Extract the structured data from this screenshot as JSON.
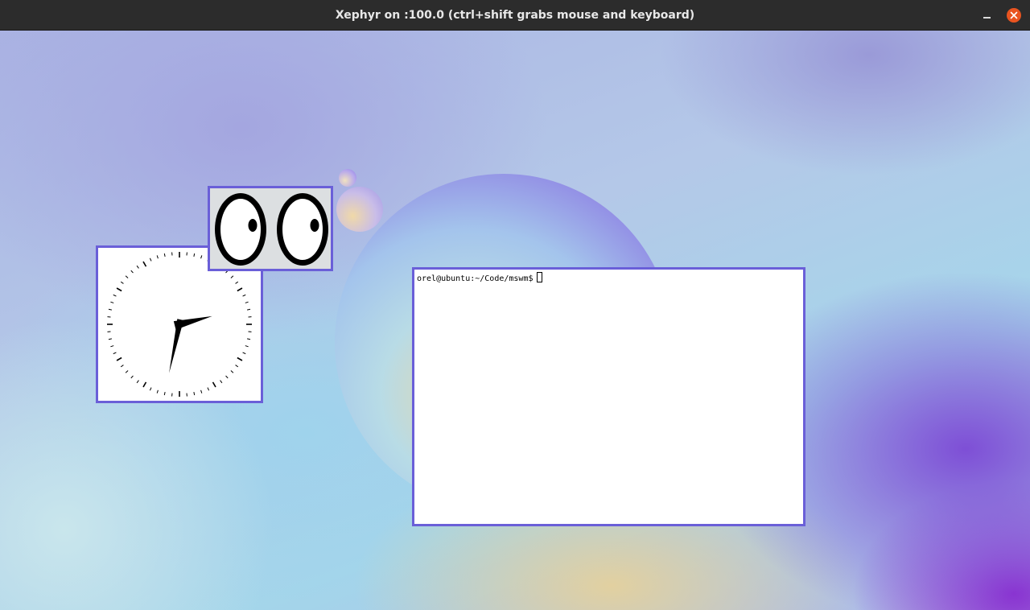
{
  "window": {
    "title": "Xephyr on :100.0 (ctrl+shift grabs mouse and keyboard)",
    "minimize_icon": "minimize-icon",
    "close_icon": "close-icon",
    "close_color": "#e95420"
  },
  "desktop": {
    "window_border_color": "#6a5fd8"
  },
  "clock": {
    "type": "analog-clock",
    "hour": 2,
    "minute": 32
  },
  "eyes": {
    "type": "xeyes"
  },
  "terminal": {
    "prompt": "orel@ubuntu:~/Code/mswm$",
    "cursor_icon": "block-cursor-icon"
  }
}
